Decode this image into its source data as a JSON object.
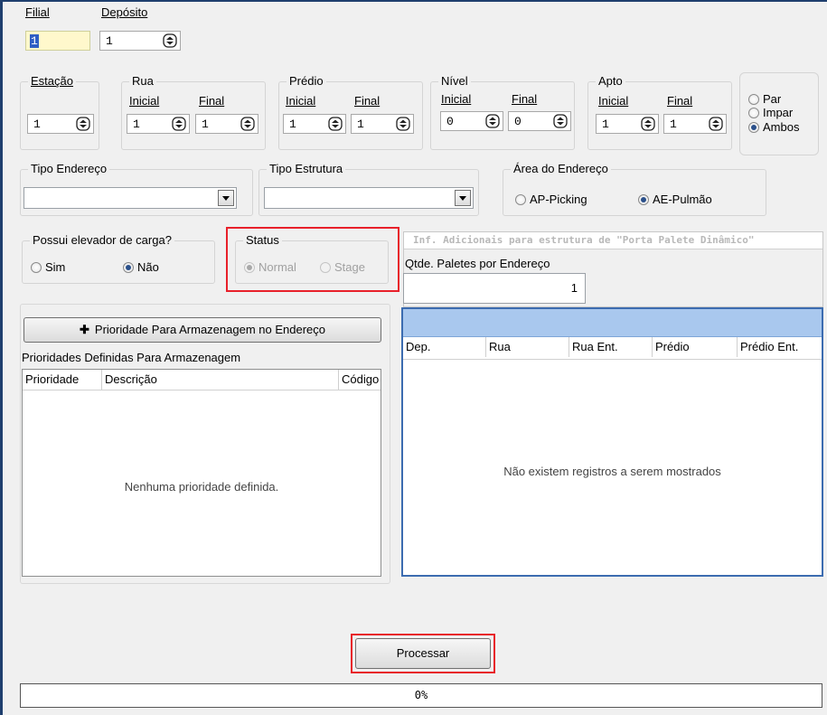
{
  "filial": {
    "label": "Filial",
    "value": "1"
  },
  "deposito": {
    "label": "Depósito",
    "value": "1"
  },
  "estacao": {
    "label": "Estação",
    "value": "1"
  },
  "rua": {
    "label": "Rua",
    "inicial_label": "Inicial",
    "final_label": "Final",
    "inicial": "1",
    "final": "1"
  },
  "predio": {
    "label": "Prédio",
    "inicial_label": "Inicial",
    "final_label": "Final",
    "inicial": "1",
    "final": "1"
  },
  "nivel": {
    "label": "Nível",
    "inicial_label": "Inicial",
    "final_label": "Final",
    "inicial": "0",
    "final": "0"
  },
  "apto": {
    "label": "Apto",
    "inicial_label": "Inicial",
    "final_label": "Final",
    "inicial": "1",
    "final": "1"
  },
  "parity": {
    "options": [
      "Par",
      "Impar",
      "Ambos"
    ],
    "selected": "Ambos"
  },
  "tipo_endereco": {
    "label": "Tipo Endereço",
    "value": ""
  },
  "tipo_estrutura": {
    "label": "Tipo Estrutura",
    "value": ""
  },
  "area": {
    "label": "Área do Endereço",
    "options": [
      "AP-Picking",
      "AE-Pulmão"
    ],
    "selected": "AE-Pulmão"
  },
  "elevador": {
    "label": "Possui elevador de carga?",
    "options": [
      "Sim",
      "Não"
    ],
    "selected": "Não"
  },
  "status": {
    "label": "Status",
    "options": [
      "Normal",
      "Stage"
    ],
    "selected": "Normal"
  },
  "inf_adicionais": {
    "banner": "Inf. Adicionais para estrutura de \"Porta Palete Dinâmico\"",
    "qtde_label": "Qtde. Paletes por Endereço",
    "qtde_value": "1"
  },
  "prioridade": {
    "add_button": "Prioridade Para Armazenagem no Endereço",
    "section_label": "Prioridades Definidas Para Armazenagem",
    "columns": [
      "Prioridade",
      "Descrição",
      "Código"
    ],
    "empty_text": "Nenhuma prioridade definida."
  },
  "grid": {
    "columns": [
      "Dep.",
      "Rua",
      "Rua Ent.",
      "Prédio",
      "Prédio Ent."
    ],
    "empty_text": "Não existem registros a serem mostrados"
  },
  "process_button": "Processar",
  "progress": {
    "text": "0%",
    "value": 0
  },
  "colors": {
    "highlight": "#e8202a",
    "grid_header": "#a9c8ee",
    "grid_border": "#3c6cb0",
    "banner_text": "#b8b8b8"
  }
}
